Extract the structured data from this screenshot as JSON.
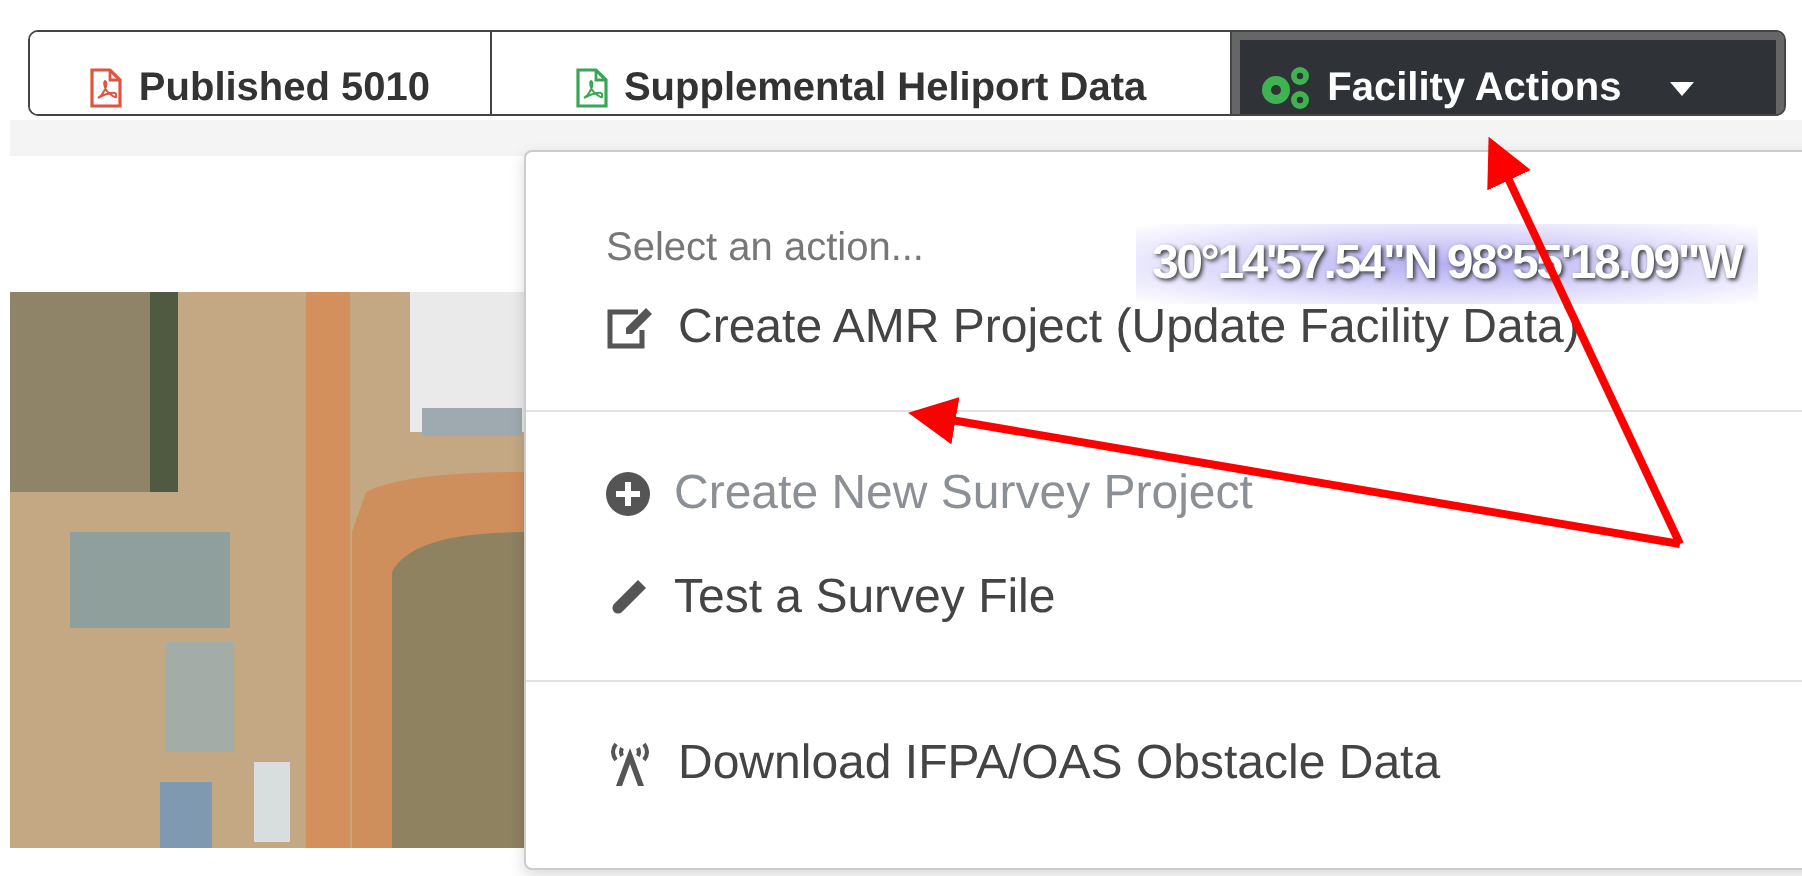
{
  "toolbar": {
    "buttons": [
      {
        "label": "Published 5010",
        "kind": "link",
        "selected": false,
        "color": "#e0533f"
      },
      {
        "label": "Supplemental Heliport Data",
        "kind": "link",
        "selected": false,
        "color": "#3aa655"
      },
      {
        "label": "Facility Actions",
        "kind": "dropdown",
        "selected": true,
        "color": "#3fb34f"
      }
    ]
  },
  "map": {
    "coordinates": "30°14'57.54\"N 98°55'18.09\"W"
  },
  "menu": {
    "sections": [
      {
        "header": "Select an action...",
        "items": [
          {
            "label": "Create AMR Project (Update Facility Data)",
            "disabled": false
          }
        ]
      },
      {
        "items": [
          {
            "label": "Create New Survey Project",
            "disabled": true
          },
          {
            "label": "Test a Survey File",
            "disabled": false
          }
        ]
      },
      {
        "items": [
          {
            "label": "Download IFPA/OAS Obstacle Data",
            "disabled": false
          }
        ]
      }
    ]
  }
}
